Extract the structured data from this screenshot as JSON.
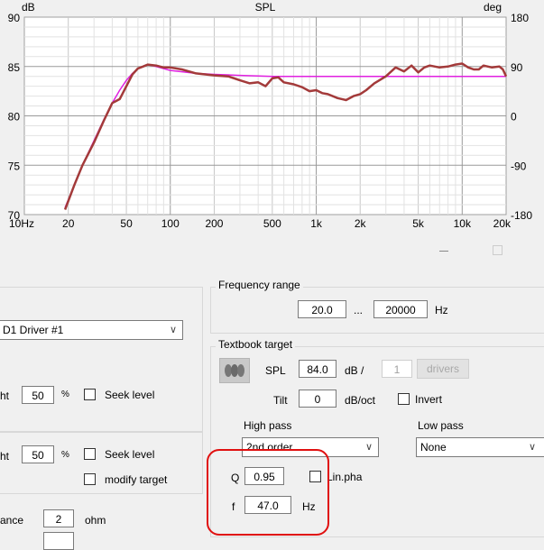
{
  "chart": {
    "title": "SPL",
    "left_unit": "dB",
    "right_unit": "deg",
    "left_ticks": [
      "90",
      "85",
      "80",
      "75",
      "70"
    ],
    "right_ticks": [
      "180",
      "90",
      "0",
      "-90",
      "-180"
    ],
    "x_ticks": [
      "10Hz",
      "20",
      "50",
      "100",
      "200",
      "500",
      "1k",
      "2k",
      "5k",
      "10k",
      "20k"
    ]
  },
  "chart_data": {
    "type": "line",
    "title": "SPL",
    "xlabel": "",
    "ylabel": "dB",
    "x_scale": "log",
    "xlim": [
      10,
      20000
    ],
    "ylim": [
      70,
      90
    ],
    "y2lim": [
      -180,
      180
    ],
    "grid": true,
    "series": [
      {
        "color": "#a33a3a",
        "x": [
          19,
          22,
          25,
          30,
          35,
          40,
          45,
          50,
          55,
          60,
          65,
          70,
          80,
          90,
          100,
          120,
          150,
          200,
          250,
          300,
          350,
          400,
          450,
          500,
          550,
          600,
          700,
          800,
          900,
          1000,
          1100,
          1200,
          1400,
          1600,
          1800,
          2000,
          2200,
          2500,
          3000,
          3500,
          4000,
          4500,
          5000,
          5500,
          6000,
          7000,
          8000,
          9000,
          10000,
          11000,
          12000,
          13000,
          14000,
          16000,
          18000,
          19000,
          20000
        ],
        "y": [
          70.5,
          73.0,
          75.0,
          77.3,
          79.5,
          81.3,
          81.7,
          83.0,
          84.2,
          84.8,
          85.0,
          85.2,
          85.1,
          84.9,
          84.9,
          84.7,
          84.3,
          84.1,
          84.0,
          83.6,
          83.3,
          83.4,
          83.0,
          83.8,
          83.9,
          83.4,
          83.2,
          82.9,
          82.5,
          82.6,
          82.3,
          82.2,
          81.8,
          81.6,
          82.0,
          82.2,
          82.6,
          83.3,
          84.0,
          84.9,
          84.5,
          85.1,
          84.4,
          84.9,
          85.1,
          84.9,
          85.0,
          85.2,
          85.3,
          84.9,
          84.7,
          84.7,
          85.1,
          84.9,
          85.0,
          84.7,
          84.0
        ]
      },
      {
        "color": "#e020e0",
        "x": [
          19,
          25,
          30,
          35,
          40,
          45,
          50,
          55,
          60,
          70,
          80,
          100,
          150,
          200,
          300,
          500,
          1000,
          5000,
          20000
        ],
        "y": [
          70.7,
          75.0,
          77.5,
          79.6,
          81.3,
          82.6,
          83.6,
          84.3,
          84.8,
          85.2,
          85.0,
          84.6,
          84.3,
          84.2,
          84.1,
          84.0,
          84.0,
          84.0,
          84.0
        ]
      }
    ]
  },
  "panel": {
    "driver_select": "D1 Driver #1",
    "row1_prefix": "ht",
    "row1_value": "50",
    "row1_unit": "%",
    "row1_check": "Seek level",
    "row2_prefix": "ht",
    "row2_value": "50",
    "row2_unit": "%",
    "row2_check": "Seek level",
    "modify_target": "modify target",
    "impedance_label": "ance",
    "impedance_value": "2",
    "impedance_unit": "ohm"
  },
  "freq_range": {
    "title": "Frequency range",
    "low": "20.0",
    "sep": "...",
    "high": "20000",
    "unit": "Hz"
  },
  "target": {
    "title": "Textbook target",
    "spl_label": "SPL",
    "spl_value": "84.0",
    "spl_unit": "dB /",
    "drivers_count": "1",
    "drivers_button": "drivers",
    "tilt_label": "Tilt",
    "tilt_value": "0",
    "tilt_unit": "dB/oct",
    "invert_label": "Invert",
    "high_pass_label": "High pass",
    "high_pass_value": "2nd order",
    "low_pass_label": "Low pass",
    "low_pass_value": "None",
    "q_label": "Q",
    "q_value": "0.95",
    "linpha_label": "Lin.pha",
    "f_label": "f",
    "f_value": "47.0",
    "f_unit": "Hz"
  }
}
